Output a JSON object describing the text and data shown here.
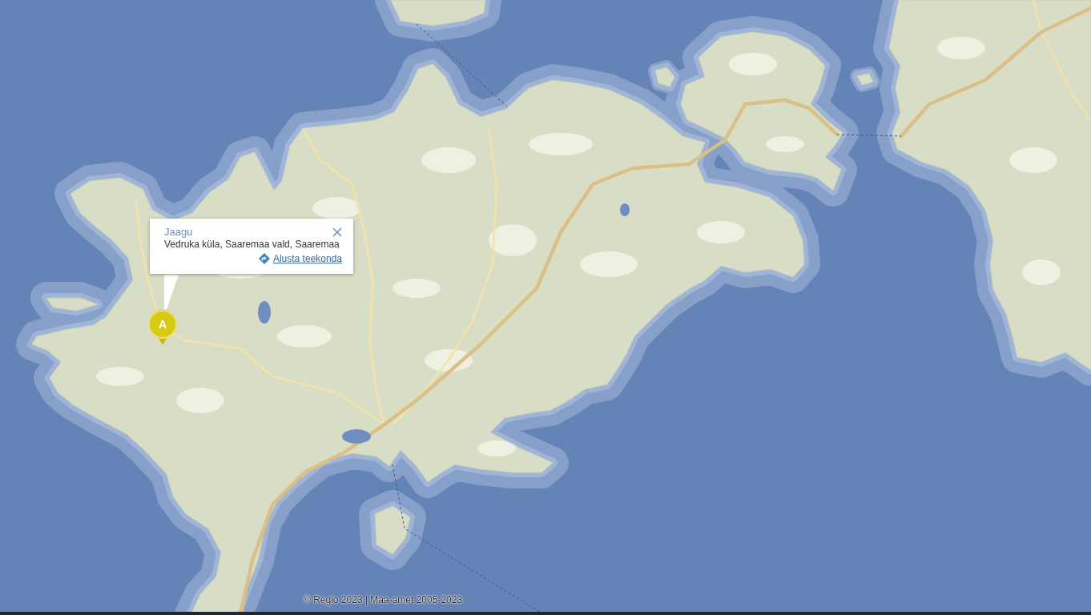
{
  "marker": {
    "label": "A"
  },
  "popup": {
    "title": "Jaagu",
    "address": "Vedruka küla, Saaremaa vald, Saaremaa",
    "link": "Alusta teekonda"
  },
  "attribution": "© Regio 2023 | Maa-amet 2005-2023"
}
